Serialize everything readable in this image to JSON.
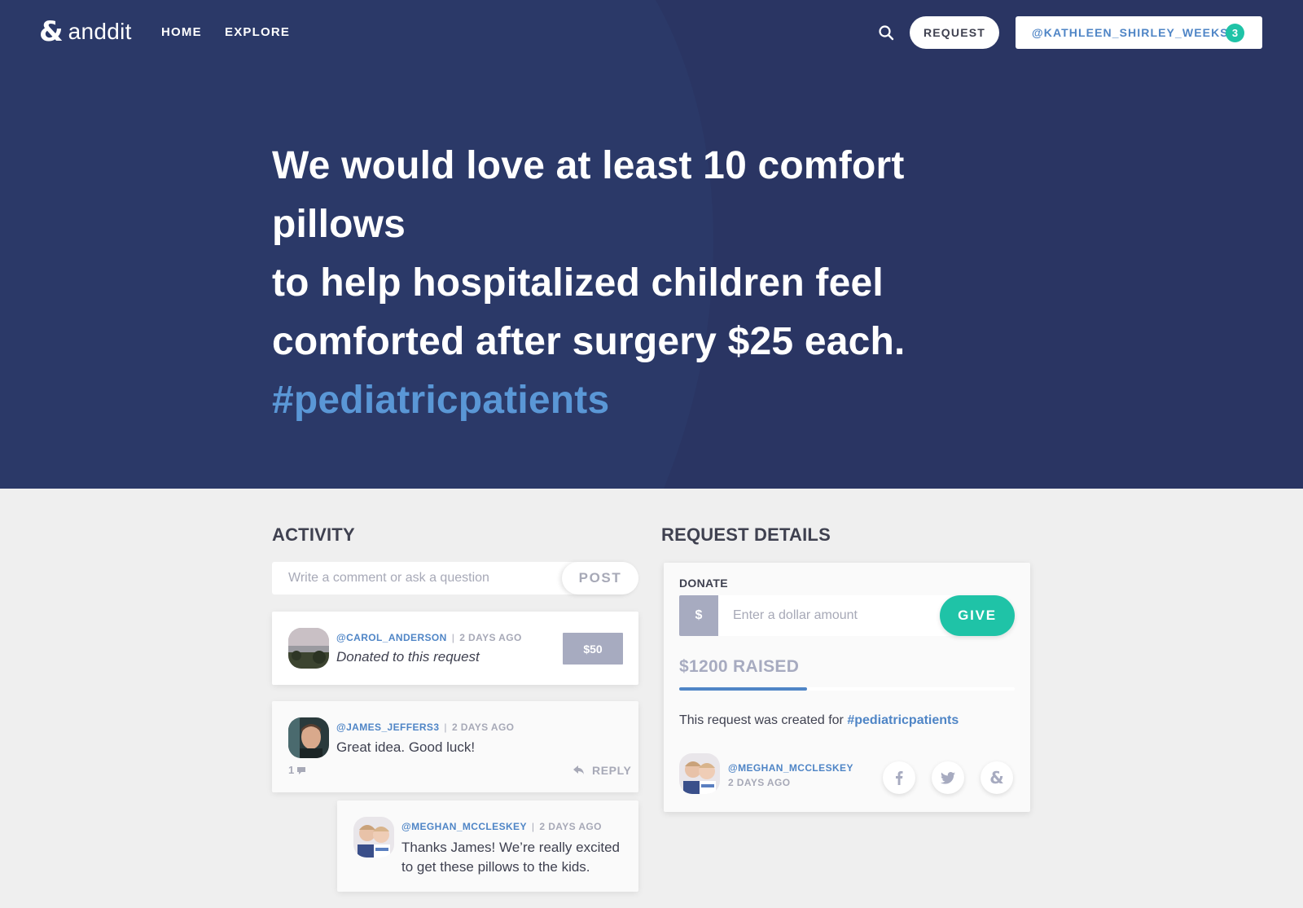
{
  "brand": {
    "amp": "&",
    "name": "anddit"
  },
  "nav": {
    "home": "HOME",
    "explore": "EXPLORE"
  },
  "header": {
    "request_label": "REQUEST",
    "user_handle": "@KATHLEEN_SHIRLEY_WEEKS",
    "notification_count": "3"
  },
  "hero": {
    "line1": "We would love at least 10 comfort pillows",
    "line2": "to help hospitalized children feel",
    "line3": "comforted after surgery $25 each.",
    "hashtag": "#pediatricpatients"
  },
  "activity": {
    "title": "ACTIVITY",
    "comment_placeholder": "Write a comment or ask a question",
    "post_label": "POST",
    "items": [
      {
        "handle": "@CAROL_ANDERSON",
        "separator": "|",
        "ago": "2 DAYS AGO",
        "text": "Donated to this request",
        "amount": "$50"
      },
      {
        "handle": "@JAMES_JEFFERS3",
        "separator": "|",
        "ago": "2 DAYS AGO",
        "text": "Great idea. Good luck!",
        "likes": "1",
        "reply_label": "REPLY"
      },
      {
        "handle": "@MEGHAN_MCCLESKEY",
        "separator": "|",
        "ago": "2 DAYS AGO",
        "text_line1": "Thanks James! We’re really excited",
        "text_line2": "to get these pillows to the kids."
      }
    ]
  },
  "details": {
    "title": "REQUEST DETAILS",
    "donate_label": "DONATE",
    "currency_symbol": "$",
    "amount_placeholder": "Enter a dollar amount",
    "give_label": "GIVE",
    "raised": "$1200 RAISED",
    "progress_fraction": 0.38,
    "created_prefix": "This request was created for",
    "created_tag": "#pediatricpatients",
    "creator_handle": "@MEGHAN_MCCLESKEY",
    "creator_ago": "2 DAYS AGO",
    "share_amp": "&"
  },
  "colors": {
    "hero_bg": "#2b3968",
    "accent_blue": "#4f85c6",
    "accent_green": "#1fc3a7",
    "muted": "#a7abc0"
  }
}
